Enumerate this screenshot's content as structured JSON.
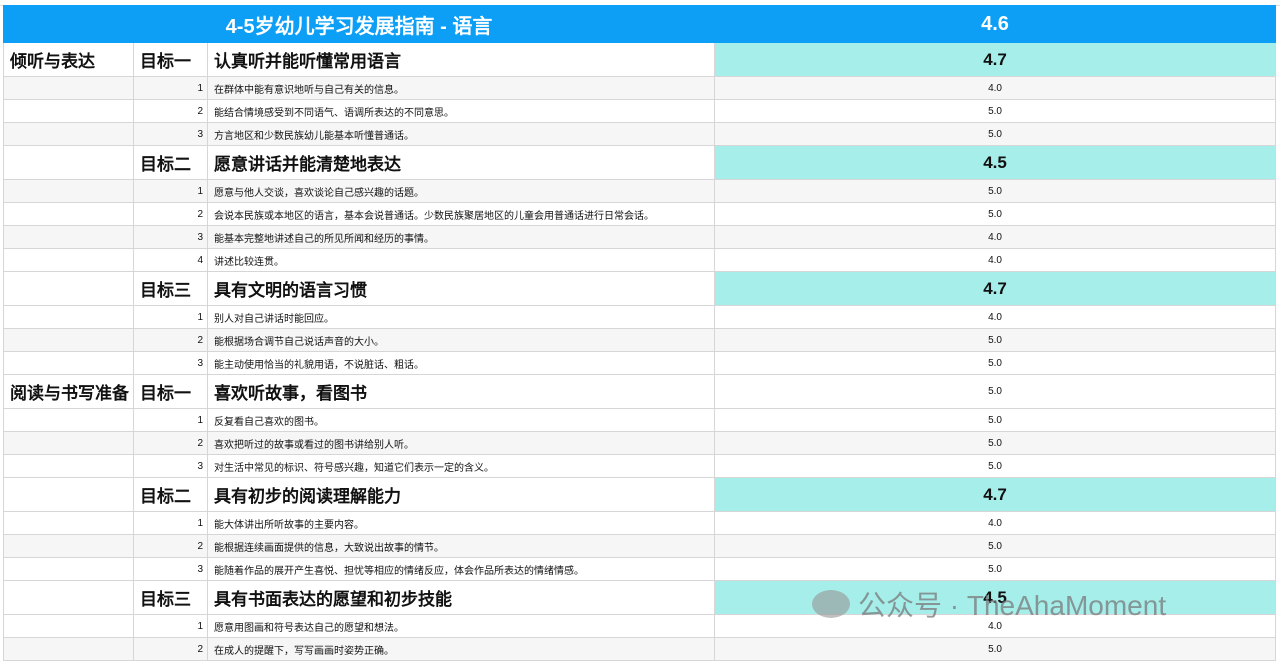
{
  "title": "4-5岁幼儿学习发展指南 - 语言",
  "overall": "4.6",
  "sections": [
    {
      "name": "倾听与表达",
      "goals": [
        {
          "goal": "目标一",
          "title": "认真听并能听懂常用语言",
          "score": "4.7",
          "highlight": true,
          "items": [
            {
              "n": "1",
              "text": "在群体中能有意识地听与自己有关的信息。",
              "v": "4.0"
            },
            {
              "n": "2",
              "text": "能结合情境感受到不同语气、语调所表达的不同意思。",
              "v": "5.0"
            },
            {
              "n": "3",
              "text": "方言地区和少数民族幼儿能基本听懂普通话。",
              "v": "5.0"
            }
          ]
        },
        {
          "goal": "目标二",
          "title": "愿意讲话并能清楚地表达",
          "score": "4.5",
          "highlight": true,
          "items": [
            {
              "n": "1",
              "text": "愿意与他人交谈，喜欢谈论自己感兴趣的话题。",
              "v": "5.0"
            },
            {
              "n": "2",
              "text": "会说本民族或本地区的语言，基本会说普通话。少数民族聚居地区的儿童会用普通话进行日常会话。",
              "v": "5.0"
            },
            {
              "n": "3",
              "text": "能基本完整地讲述自己的所见所闻和经历的事情。",
              "v": "4.0"
            },
            {
              "n": "4",
              "text": "讲述比较连贯。",
              "v": "4.0"
            }
          ]
        },
        {
          "goal": "目标三",
          "title": "具有文明的语言习惯",
          "score": "4.7",
          "highlight": true,
          "items": [
            {
              "n": "1",
              "text": "别人对自己讲话时能回应。",
              "v": "4.0"
            },
            {
              "n": "2",
              "text": "能根据场合调节自己说话声音的大小。",
              "v": "5.0"
            },
            {
              "n": "3",
              "text": "能主动使用恰当的礼貌用语，不说脏话、粗话。",
              "v": "5.0"
            }
          ]
        }
      ]
    },
    {
      "name": "阅读与书写准备",
      "goals": [
        {
          "goal": "目标一",
          "title": "喜欢听故事，看图书",
          "score": "5.0",
          "highlight": false,
          "items": [
            {
              "n": "1",
              "text": "反复看自己喜欢的图书。",
              "v": "5.0"
            },
            {
              "n": "2",
              "text": "喜欢把听过的故事或看过的图书讲给别人听。",
              "v": "5.0"
            },
            {
              "n": "3",
              "text": "对生活中常见的标识、符号感兴趣，知道它们表示一定的含义。",
              "v": "5.0"
            }
          ]
        },
        {
          "goal": "目标二",
          "title": "具有初步的阅读理解能力",
          "score": "4.7",
          "highlight": true,
          "items": [
            {
              "n": "1",
              "text": "能大体讲出所听故事的主要内容。",
              "v": "4.0"
            },
            {
              "n": "2",
              "text": "能根据连续画面提供的信息，大致说出故事的情节。",
              "v": "5.0"
            },
            {
              "n": "3",
              "text": "能随着作品的展开产生喜悦、担忧等相应的情绪反应，体会作品所表达的情绪情感。",
              "v": "5.0"
            }
          ]
        },
        {
          "goal": "目标三",
          "title": "具有书面表达的愿望和初步技能",
          "score": "4.5",
          "highlight": true,
          "items": [
            {
              "n": "1",
              "text": "愿意用图画和符号表达自己的愿望和想法。",
              "v": "4.0"
            },
            {
              "n": "2",
              "text": "在成人的提醒下，写写画画时姿势正确。",
              "v": "5.0"
            }
          ]
        }
      ]
    }
  ],
  "watermark": "公众号 · TheAhaMoment"
}
